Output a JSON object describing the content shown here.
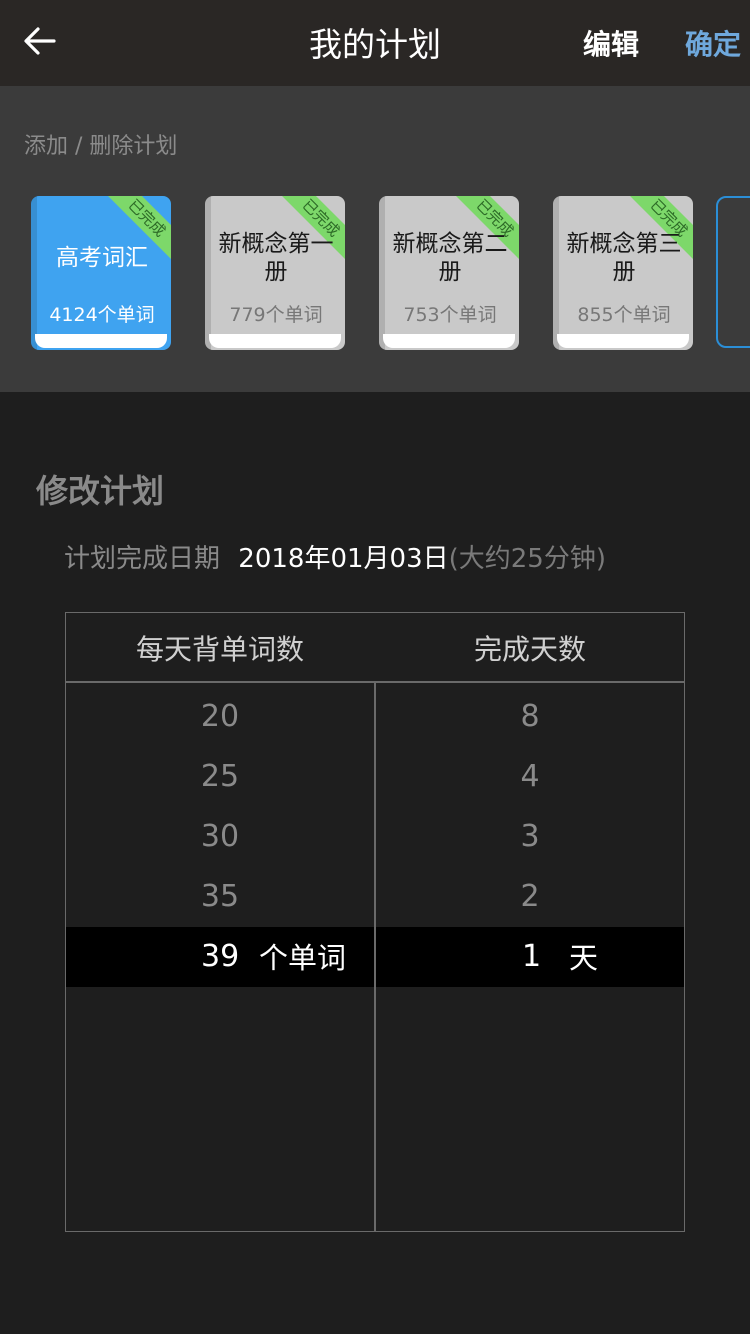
{
  "nav": {
    "title": "我的计划",
    "edit_label": "编辑",
    "confirm_label": "确定",
    "accent_color": "#6fa8dc"
  },
  "plans": {
    "add_remove_label": "添加 / 删除计划",
    "books": [
      {
        "title": "高考词汇",
        "count": "4124个单词",
        "badge": "已完成",
        "selected": true
      },
      {
        "title": "新概念第一册",
        "count": "779个单词",
        "badge": "已完成",
        "selected": false
      },
      {
        "title": "新概念第二册",
        "count": "753个单词",
        "badge": "已完成",
        "selected": false
      },
      {
        "title": "新概念第三册",
        "count": "855个单词",
        "badge": "已完成",
        "selected": false
      }
    ]
  },
  "modify": {
    "title": "修改计划",
    "date_label": "计划完成日期",
    "date_value": "2018年01月03日",
    "duration": "(大约25分钟)"
  },
  "picker": {
    "col1_header": "每天背单词数",
    "col2_header": "完成天数",
    "col1_options": [
      "20",
      "25",
      "30",
      "35"
    ],
    "col2_options": [
      "8",
      "4",
      "3",
      "2"
    ],
    "col1_selected": "39",
    "col1_unit": "个单词",
    "col2_selected": "1",
    "col2_unit": "天"
  }
}
